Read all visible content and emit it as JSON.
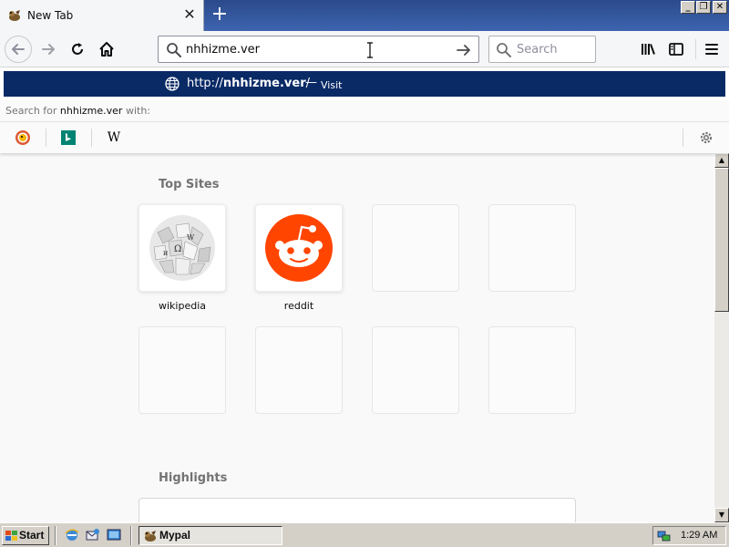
{
  "tab": {
    "title": "New Tab",
    "close_label": "✕",
    "new_tab_label": "+"
  },
  "window_controls": {
    "minimize": "_",
    "restore": "❐",
    "close": "✕"
  },
  "urlbar": {
    "value": "nhhizme.ver"
  },
  "searchbar": {
    "placeholder": "Search"
  },
  "autocomplete": {
    "visit_url_prefix": "http://",
    "visit_url_host": "nhhizme.ver",
    "visit_url_suffix": "/",
    "separator": "—",
    "action": "Visit",
    "search_for_prefix": "Search for ",
    "search_for_term": "nhhizme.ver",
    "search_for_suffix": " with:",
    "engines": [
      "DuckDuckGo",
      "Bing",
      "Wikipedia"
    ]
  },
  "top_sites": {
    "title": "Top Sites",
    "tiles": [
      {
        "label": "wikipedia"
      },
      {
        "label": "reddit"
      }
    ]
  },
  "highlights": {
    "title": "Highlights"
  },
  "taskbar": {
    "start_label": "Start",
    "task_label": "Mypal",
    "clock": "1:29 AM"
  },
  "colors": {
    "visit_row_bg": "#0a2a66",
    "reddit_orange": "#ff4500",
    "titlebar_blue": "#2b4a8a"
  }
}
